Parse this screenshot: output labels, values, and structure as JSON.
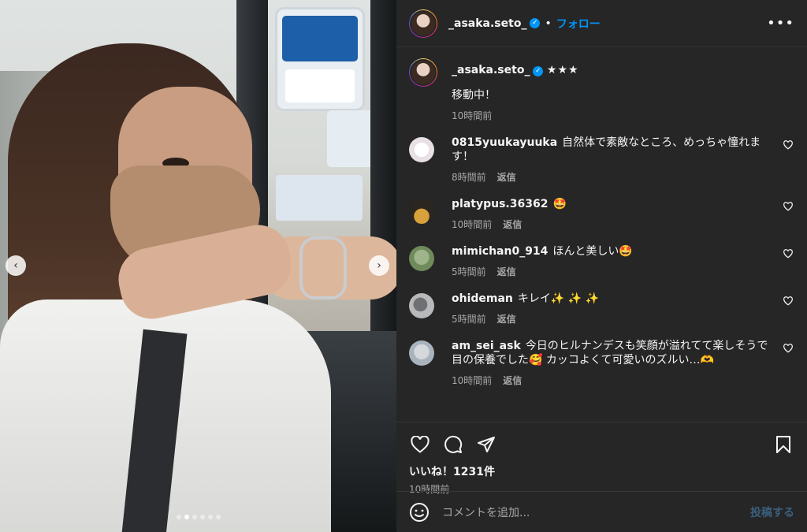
{
  "header": {
    "username": "_asaka.seto_",
    "separator": "•",
    "follow_label": "フォロー",
    "more_label": "•••"
  },
  "caption": {
    "username": "_asaka.seto_",
    "stars": "★★★",
    "text": "移動中！",
    "time": "10時間前"
  },
  "comments": [
    {
      "username": "0815yuukayuuka",
      "text": "自然体で素敵なところ、めっちゃ憧れます！",
      "time": "8時間前",
      "reply": "返信"
    },
    {
      "username": "platypus.36362",
      "text": "🤩",
      "time": "10時間前",
      "reply": "返信"
    },
    {
      "username": "mimichan0_914",
      "text": "ほんと美しい🤩",
      "time": "5時間前",
      "reply": "返信"
    },
    {
      "username": "ohideman",
      "text": "キレイ✨ ✨ ✨",
      "time": "5時間前",
      "reply": "返信"
    },
    {
      "username": "am_sei_ask",
      "text": "今日のヒルナンデスも笑顔が溢れてて楽しそうで目の保養でした🥰 カッコよくて可愛いのズルい…🫶",
      "time": "10時間前",
      "reply": "返信"
    }
  ],
  "actions": {
    "likes": "いいね！1231件",
    "posted": "10時間前"
  },
  "add_comment": {
    "placeholder": "コメントを追加...",
    "post_label": "投稿する"
  },
  "carousel": {
    "prev_label": "‹",
    "next_label": "›",
    "slide_count": 6,
    "active_slide": 2
  },
  "colors": {
    "panel_bg": "#262626",
    "accent": "#0095f6",
    "muted": "#a8a8a8"
  }
}
